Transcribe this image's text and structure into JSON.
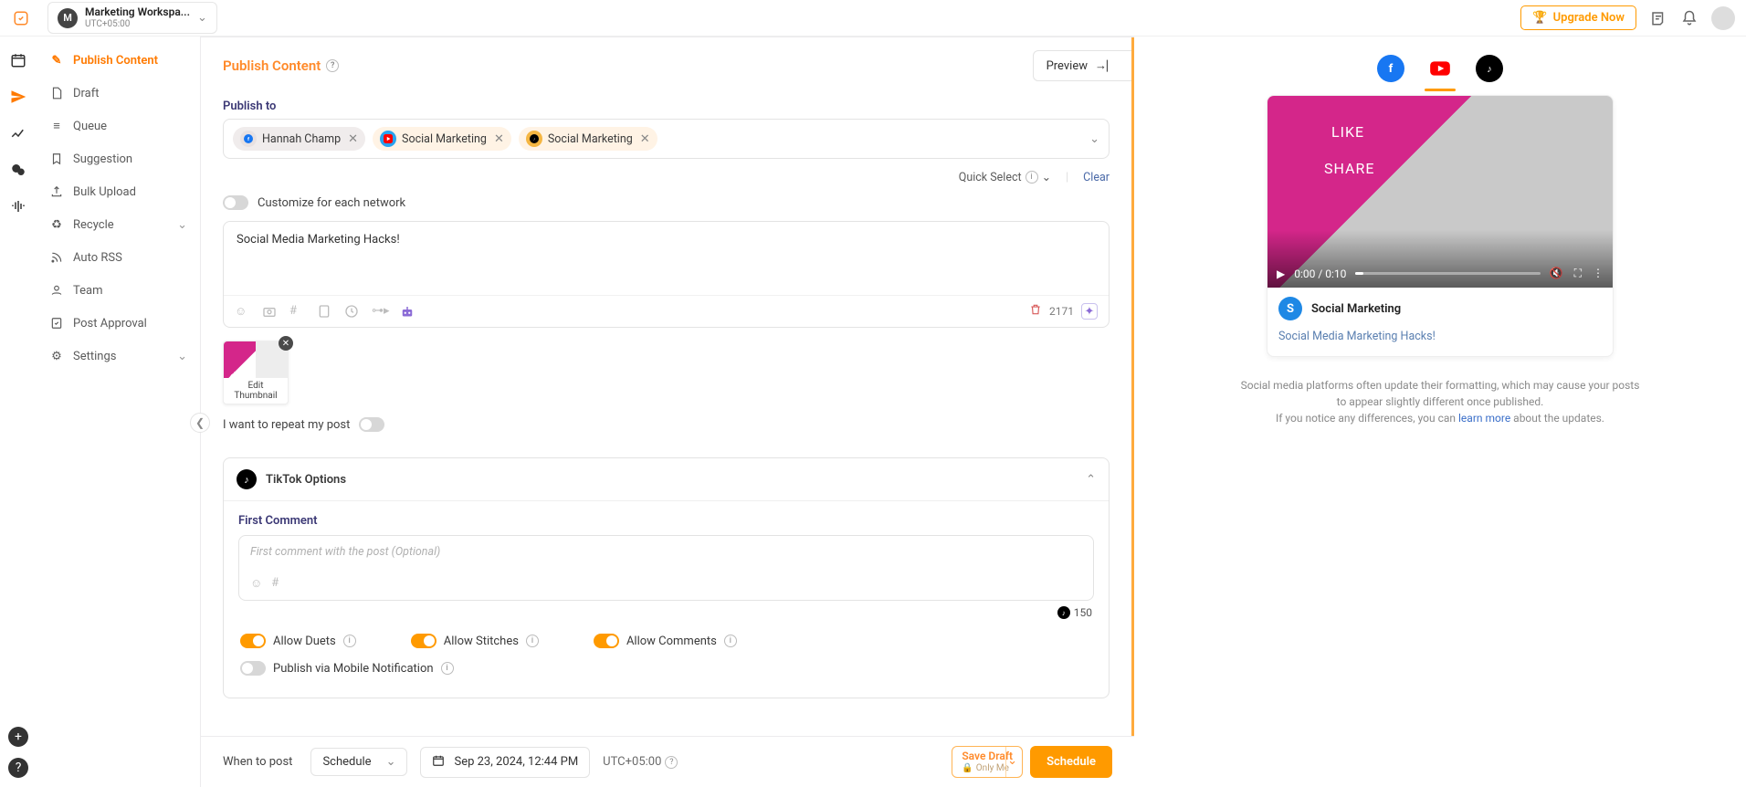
{
  "topbar": {
    "workspace_letter": "M",
    "workspace_name": "Marketing Workspa...",
    "workspace_tz": "UTC+05:00",
    "upgrade_label": "Upgrade Now"
  },
  "sidenav": {
    "items": [
      {
        "label": "Publish Content"
      },
      {
        "label": "Draft"
      },
      {
        "label": "Queue"
      },
      {
        "label": "Suggestion"
      },
      {
        "label": "Bulk Upload"
      },
      {
        "label": "Recycle"
      },
      {
        "label": "Auto RSS"
      },
      {
        "label": "Team"
      },
      {
        "label": "Post Approval"
      },
      {
        "label": "Settings"
      }
    ]
  },
  "main": {
    "title": "Publish Content",
    "preview_label": "Preview",
    "publish_to_label": "Publish to",
    "accounts": [
      {
        "name": "Hannah Champ",
        "net": "fb"
      },
      {
        "name": "Social Marketing",
        "net": "yt"
      },
      {
        "name": "Social Marketing",
        "net": "tt"
      }
    ],
    "quick_select": "Quick Select",
    "clear": "Clear",
    "customize_label": "Customize for each network",
    "editor_text": "Social Media Marketing Hacks!",
    "char_count": "2171",
    "thumb_caption": "Edit Thumbnail",
    "repeat_label": "I want to repeat my post",
    "tiktok": {
      "head": "TikTok Options",
      "first_comment_label": "First Comment",
      "first_comment_placeholder": "First comment with the post (Optional)",
      "fc_count": "150",
      "allow_duets": "Allow Duets",
      "allow_stitches": "Allow Stitches",
      "allow_comments": "Allow Comments",
      "mobile_notif": "Publish via Mobile Notification"
    }
  },
  "footer": {
    "when_label": "When to post",
    "mode": "Schedule",
    "datetime": "Sep 23, 2024, 12:44 PM",
    "tz": "UTC+05:00",
    "save_draft": "Save Draft",
    "only_me": "Only Me",
    "schedule_btn": "Schedule"
  },
  "preview": {
    "like": "LIKE",
    "share": "SHARE",
    "time": "0:00 / 0:10",
    "channel_letter": "S",
    "channel_name": "Social Marketing",
    "caption": "Social Media Marketing Hacks!",
    "disclaimer_1": "Social media platforms often update their formatting, which may cause your posts to appear slightly different once published.",
    "disclaimer_2a": "If you notice any differences, you can ",
    "disclaimer_link": "learn more",
    "disclaimer_2b": " about the updates."
  }
}
